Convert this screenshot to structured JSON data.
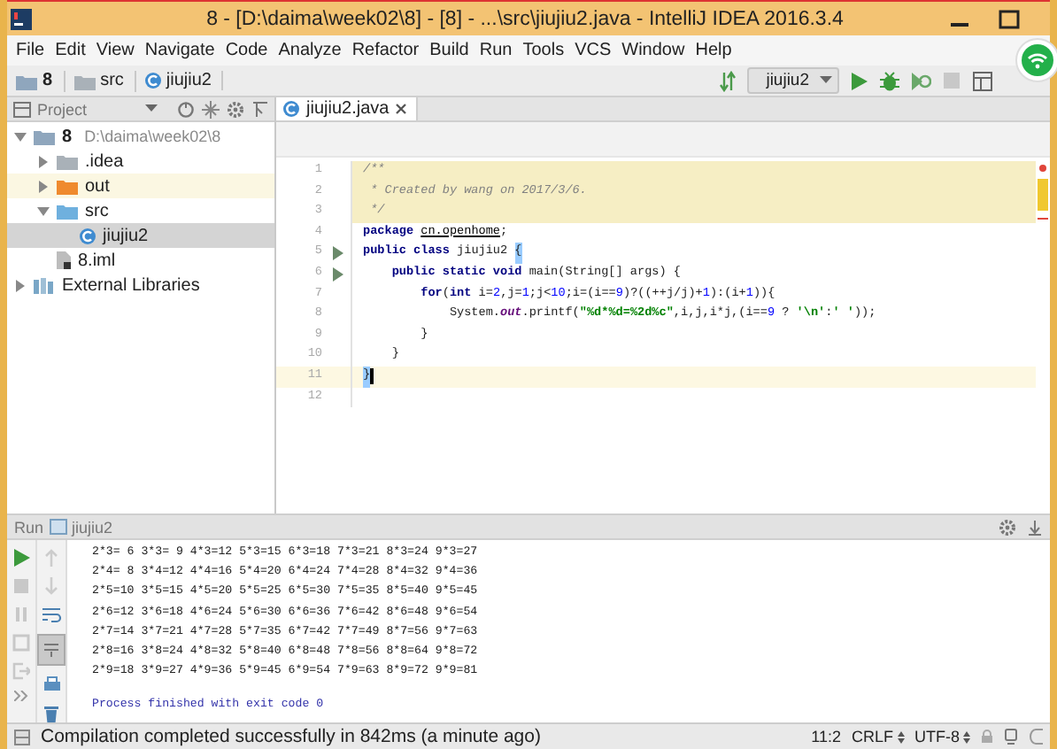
{
  "window": {
    "title": "8 - [D:\\daima\\week02\\8] - [8] - ...\\src\\jiujiu2.java - IntelliJ IDEA 2016.3.4"
  },
  "menu": [
    "File",
    "Edit",
    "View",
    "Navigate",
    "Code",
    "Analyze",
    "Refactor",
    "Build",
    "Run",
    "Tools",
    "VCS",
    "Window",
    "Help"
  ],
  "navbar": {
    "crumbs": [
      {
        "label": "8",
        "kind": "module"
      },
      {
        "label": "src",
        "kind": "folder"
      },
      {
        "label": "jiujiu2",
        "kind": "class"
      }
    ],
    "run_config": "jiujiu2"
  },
  "project_panel": {
    "title": "Project",
    "tree": [
      {
        "label": "8",
        "path": "D:\\daima\\week02\\8",
        "kind": "module",
        "expanded": true,
        "selected": false,
        "children": [
          {
            "label": ".idea",
            "kind": "folder",
            "expanded": false,
            "selected": false
          },
          {
            "label": "out",
            "kind": "excluded",
            "expanded": false,
            "selected": false
          },
          {
            "label": "src",
            "kind": "source",
            "expanded": true,
            "selected": false,
            "children": [
              {
                "label": "jiujiu2",
                "kind": "class",
                "selected": true
              }
            ]
          },
          {
            "label": "8.iml",
            "kind": "file",
            "selected": false
          }
        ]
      },
      {
        "label": "External Libraries",
        "kind": "library",
        "expanded": false,
        "selected": false
      }
    ]
  },
  "editor": {
    "tab": "jiujiu2.java",
    "lines": [
      {
        "number": "1",
        "kind": "doc",
        "segments": [
          {
            "kind": "comment",
            "text": "/**"
          }
        ]
      },
      {
        "number": "2",
        "kind": "doc",
        "segments": [
          {
            "kind": "comment",
            "text": " * Created by wang on 2017/3/6."
          }
        ]
      },
      {
        "number": "3",
        "kind": "doc",
        "segments": [
          {
            "kind": "comment",
            "text": " */"
          }
        ]
      },
      {
        "number": "4",
        "kind": "code",
        "segments": [
          {
            "kind": "keyword",
            "text": "package "
          },
          {
            "kind": "link",
            "text": "cn.openhome"
          },
          {
            "kind": "plain",
            "text": ";"
          }
        ]
      },
      {
        "number": "5",
        "kind": "code",
        "run_marker": true,
        "segments": [
          {
            "kind": "keyword",
            "text": "public class "
          },
          {
            "kind": "plain",
            "text": "jiujiu2 "
          },
          {
            "kind": "brace",
            "text": "{"
          }
        ]
      },
      {
        "number": "6",
        "kind": "code",
        "run_marker": true,
        "segments": [
          {
            "kind": "keyword",
            "text": "    public static void "
          },
          {
            "kind": "plain",
            "text": "main(String[] args) {"
          }
        ]
      },
      {
        "number": "7",
        "kind": "code",
        "segments": [
          {
            "kind": "keyword",
            "text": "        for"
          },
          {
            "kind": "plain",
            "text": "("
          },
          {
            "kind": "keyword",
            "text": "int "
          },
          {
            "kind": "plain",
            "text": "i="
          },
          {
            "kind": "number",
            "text": "2"
          },
          {
            "kind": "plain",
            "text": ",j="
          },
          {
            "kind": "number",
            "text": "1"
          },
          {
            "kind": "plain",
            "text": ";j<"
          },
          {
            "kind": "number",
            "text": "10"
          },
          {
            "kind": "plain",
            "text": ";i=(i=="
          },
          {
            "kind": "number",
            "text": "9"
          },
          {
            "kind": "plain",
            "text": ")?((++j/j)+"
          },
          {
            "kind": "number",
            "text": "1"
          },
          {
            "kind": "plain",
            "text": "):(i+"
          },
          {
            "kind": "number",
            "text": "1"
          },
          {
            "kind": "plain",
            "text": ")){"
          }
        ]
      },
      {
        "number": "8",
        "kind": "code",
        "segments": [
          {
            "kind": "plain",
            "text": "            System."
          },
          {
            "kind": "field",
            "text": "out"
          },
          {
            "kind": "plain",
            "text": ".printf("
          },
          {
            "kind": "string",
            "text": "\"%d*%d=%2d%c\""
          },
          {
            "kind": "plain",
            "text": ",i,j,i*j,(i=="
          },
          {
            "kind": "number",
            "text": "9"
          },
          {
            "kind": "plain",
            "text": " ? "
          },
          {
            "kind": "string",
            "text": "'\\n'"
          },
          {
            "kind": "plain",
            "text": ":"
          },
          {
            "kind": "string",
            "text": "' '"
          },
          {
            "kind": "plain",
            "text": "));"
          }
        ]
      },
      {
        "number": "9",
        "kind": "code",
        "segments": [
          {
            "kind": "plain",
            "text": "        }"
          }
        ]
      },
      {
        "number": "10",
        "kind": "code",
        "segments": [
          {
            "kind": "plain",
            "text": "    }"
          }
        ]
      },
      {
        "number": "11",
        "kind": "code",
        "current": true,
        "segments": [
          {
            "kind": "brace",
            "text": "}"
          }
        ]
      },
      {
        "number": "12",
        "kind": "code"
      }
    ]
  },
  "run_panel": {
    "label": "Run",
    "config": "jiujiu2",
    "output": [
      "2*3= 6 3*3= 9 4*3=12 5*3=15 6*3=18 7*3=21 8*3=24 9*3=27",
      "2*4= 8 3*4=12 4*4=16 5*4=20 6*4=24 7*4=28 8*4=32 9*4=36",
      "2*5=10 3*5=15 4*5=20 5*5=25 6*5=30 7*5=35 8*5=40 9*5=45",
      "2*6=12 3*6=18 4*6=24 5*6=30 6*6=36 7*6=42 8*6=48 9*6=54",
      "2*7=14 3*7=21 4*7=28 5*7=35 6*7=42 7*7=49 8*7=56 9*7=63",
      "2*8=16 3*8=24 4*8=32 5*8=40 6*8=48 7*8=56 8*8=64 9*8=72",
      "2*9=18 3*9=27 4*9=36 5*9=45 6*9=54 7*9=63 8*9=72 9*9=81"
    ],
    "exit_message": "Process finished with exit code 0"
  },
  "status_bar": {
    "message": "Compilation completed successfully in 842ms (a minute ago)",
    "position": "11:2",
    "line_separator": "CRLF",
    "encoding": "UTF-8"
  }
}
